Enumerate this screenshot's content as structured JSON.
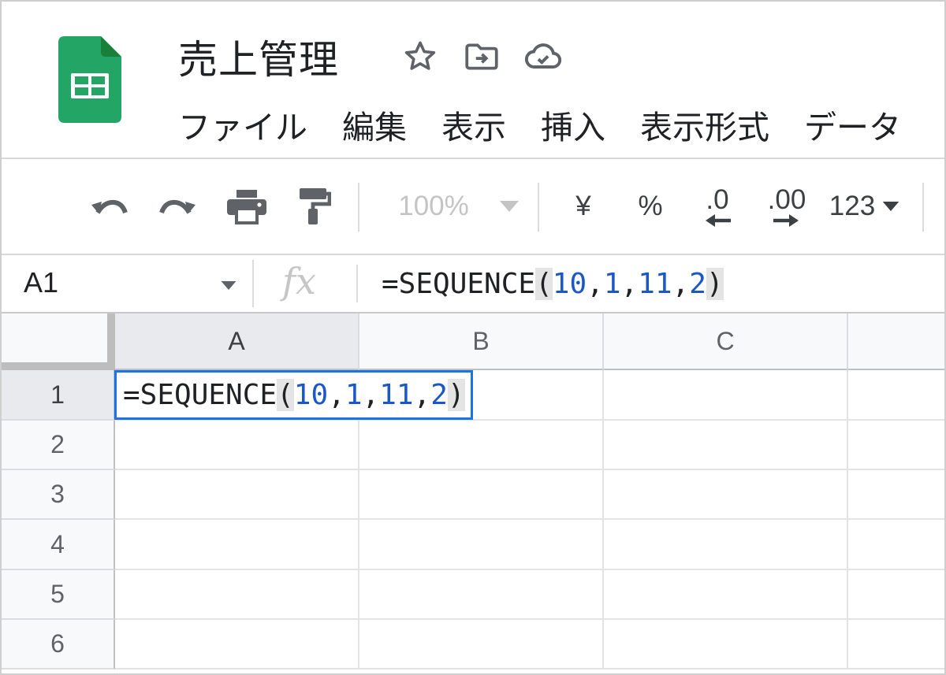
{
  "document": {
    "title": "売上管理"
  },
  "icons": {
    "logo": "google-sheets-logo",
    "star": "star-icon",
    "move": "move-to-folder-icon",
    "cloud": "cloud-saved-icon"
  },
  "menu": {
    "items": [
      "ファイル",
      "編集",
      "表示",
      "挿入",
      "表示形式",
      "データ"
    ]
  },
  "toolbar": {
    "zoom": "100%",
    "currency": "¥",
    "percent": "%",
    "decrease_decimal": ".0",
    "increase_decimal": ".00",
    "more_formats": "123"
  },
  "formula_bar": {
    "cell_ref": "A1",
    "fx_label": "fx",
    "formula": {
      "prefix": "=SEQUENCE",
      "open": "(",
      "args": [
        "10",
        "1",
        "11",
        "2"
      ],
      "close": ")"
    }
  },
  "grid": {
    "columns": [
      "A",
      "B",
      "C"
    ],
    "rows": [
      "1",
      "2",
      "3",
      "4",
      "5",
      "6"
    ],
    "active_cell": "A1"
  },
  "colors": {
    "accent": "#1a73e8",
    "number_token": "#1a57c9",
    "sheets_green": "#23a566"
  }
}
